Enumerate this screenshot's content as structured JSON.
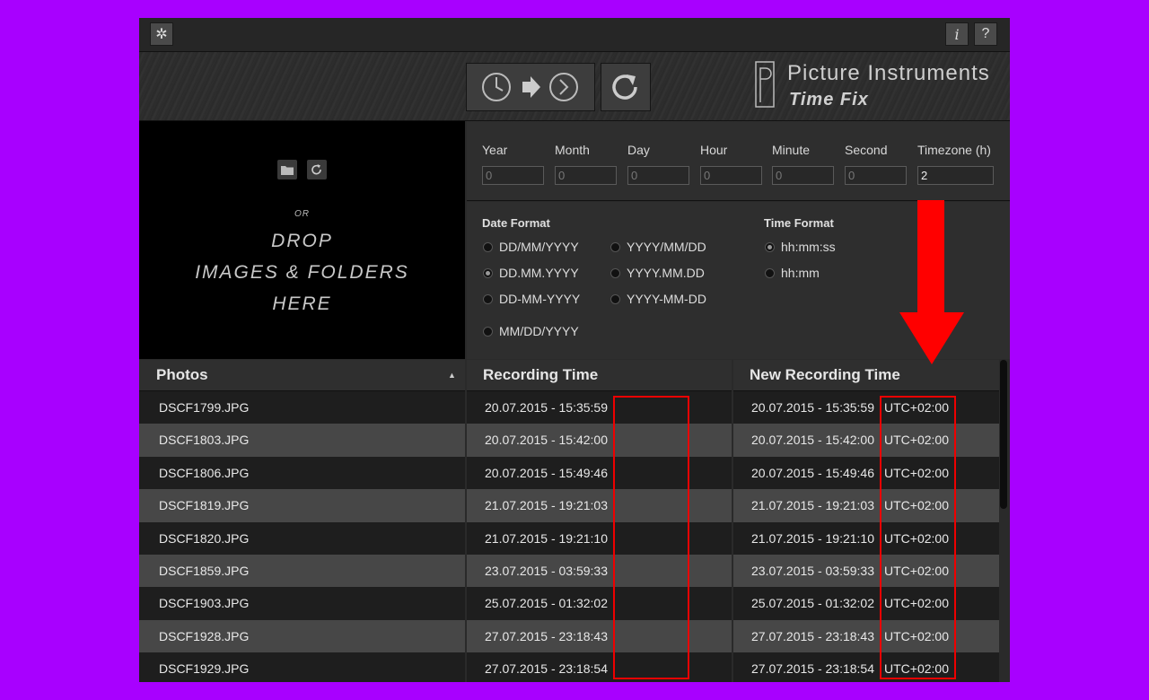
{
  "toolbar": {
    "settings_icon": "gear-icon",
    "info_label": "i",
    "help_label": "?"
  },
  "header": {
    "brand": "Picture Instruments",
    "product": "Time Fix",
    "convert_icons": [
      "clock-icon",
      "arrow-right-icon",
      "clock-forward-icon"
    ],
    "reset_icon": "refresh-icon"
  },
  "dropzone": {
    "or_text": "OR",
    "line1": "DROP",
    "line2": "IMAGES & FOLDERS",
    "line3": "HERE"
  },
  "offsets": {
    "fields": [
      {
        "label": "Year",
        "value": "0"
      },
      {
        "label": "Month",
        "value": "0"
      },
      {
        "label": "Day",
        "value": "0"
      },
      {
        "label": "Hour",
        "value": "0"
      },
      {
        "label": "Minute",
        "value": "0"
      },
      {
        "label": "Second",
        "value": "0"
      },
      {
        "label": "Timezone (h)",
        "value": "2"
      }
    ]
  },
  "date_format": {
    "title": "Date Format",
    "options": [
      "DD/MM/YYYY",
      "YYYY/MM/DD",
      "DD.MM.YYYY",
      "YYYY.MM.DD",
      "DD-MM-YYYY",
      "YYYY-MM-DD",
      "MM/DD/YYYY"
    ],
    "selected": "DD.MM.YYYY"
  },
  "time_format": {
    "title": "Time Format",
    "options": [
      "hh:mm:ss",
      "hh:mm"
    ],
    "selected": "hh:mm:ss"
  },
  "table": {
    "columns": [
      "Photos",
      "Recording Time",
      "New Recording Time"
    ],
    "sort_indicator": "▲",
    "rows": [
      {
        "photo": "DSCF1799.JPG",
        "recording": "20.07.2015 - 15:35:59",
        "new_time": "20.07.2015 - 15:35:59",
        "tz": "UTC+02:00"
      },
      {
        "photo": "DSCF1803.JPG",
        "recording": "20.07.2015 - 15:42:00",
        "new_time": "20.07.2015 - 15:42:00",
        "tz": "UTC+02:00"
      },
      {
        "photo": "DSCF1806.JPG",
        "recording": "20.07.2015 - 15:49:46",
        "new_time": "20.07.2015 - 15:49:46",
        "tz": "UTC+02:00"
      },
      {
        "photo": "DSCF1819.JPG",
        "recording": "21.07.2015 - 19:21:03",
        "new_time": "21.07.2015 - 19:21:03",
        "tz": "UTC+02:00"
      },
      {
        "photo": "DSCF1820.JPG",
        "recording": "21.07.2015 - 19:21:10",
        "new_time": "21.07.2015 - 19:21:10",
        "tz": "UTC+02:00"
      },
      {
        "photo": "DSCF1859.JPG",
        "recording": "23.07.2015 - 03:59:33",
        "new_time": "23.07.2015 - 03:59:33",
        "tz": "UTC+02:00"
      },
      {
        "photo": "DSCF1903.JPG",
        "recording": "25.07.2015 - 01:32:02",
        "new_time": "25.07.2015 - 01:32:02",
        "tz": "UTC+02:00"
      },
      {
        "photo": "DSCF1928.JPG",
        "recording": "27.07.2015 - 23:18:43",
        "new_time": "27.07.2015 - 23:18:43",
        "tz": "UTC+02:00"
      },
      {
        "photo": "DSCF1929.JPG",
        "recording": "27.07.2015 - 23:18:54",
        "new_time": "27.07.2015 - 23:18:54",
        "tz": "UTC+02:00"
      }
    ]
  },
  "colors": {
    "background": "#a800ff",
    "annotation": "#ff0000"
  }
}
